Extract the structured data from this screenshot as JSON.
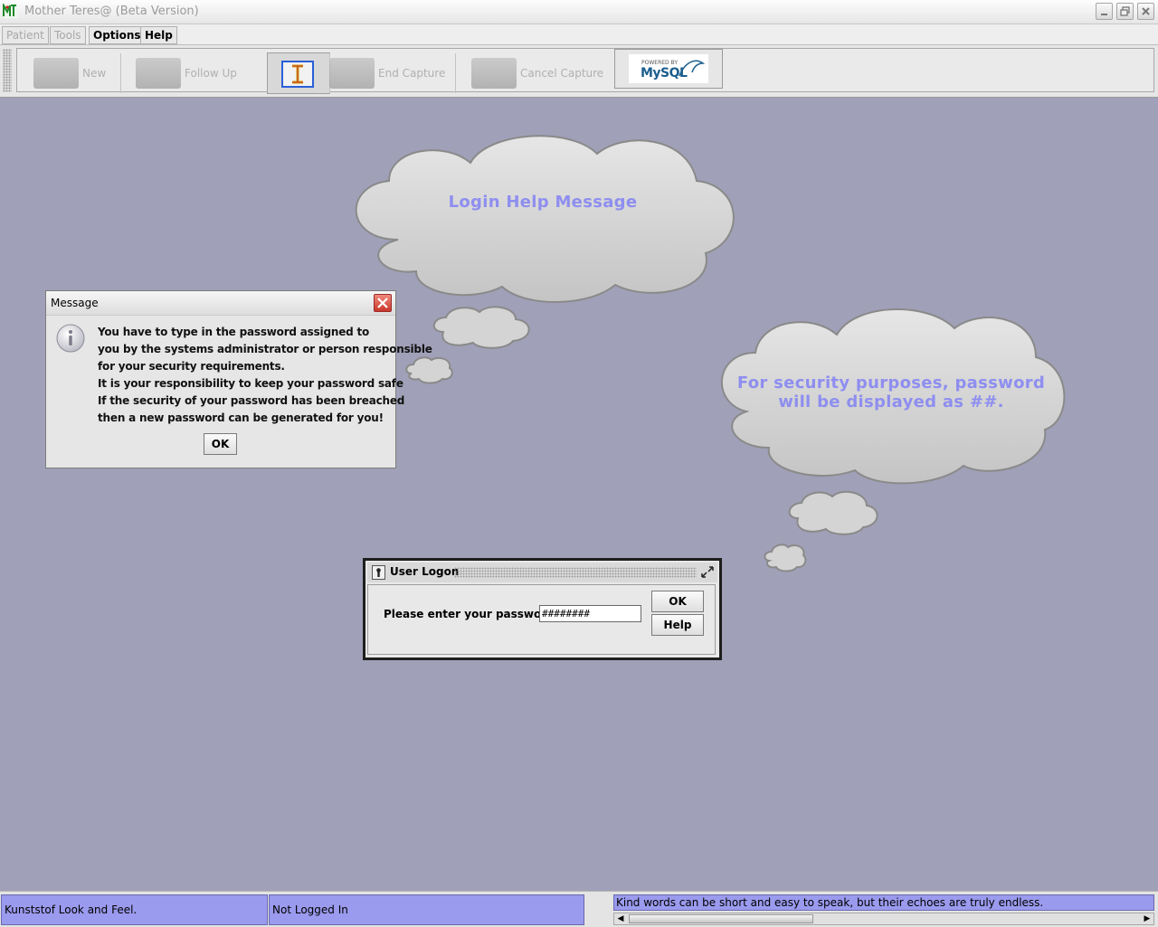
{
  "window": {
    "title": "Mother Teres@ (Beta Version)"
  },
  "menubar": {
    "items": [
      {
        "label": "Patient",
        "enabled": false
      },
      {
        "label": "Tools",
        "enabled": false
      },
      {
        "label": "Options",
        "enabled": true
      },
      {
        "label": "Help",
        "enabled": true
      }
    ]
  },
  "toolbar": {
    "new_label": "New",
    "followup_label": "Follow Up",
    "end_capture_label": "End Capture",
    "cancel_capture_label": "Cancel Capture",
    "mysql_small": "POWERED BY",
    "mysql_big": "MySQL"
  },
  "clouds": {
    "top_text": "Login Help Message",
    "right_line1": "For security purposes, password",
    "right_line2": "will be displayed as ##."
  },
  "message_dialog": {
    "title": "Message",
    "lines": [
      "You have to type in the password assigned to",
      "you by the systems administrator or person responsible",
      "for your security requirements.",
      "It is your responsibility to keep your password safe",
      "If the security of your password has been breached",
      "then a new password can be generated for you!"
    ],
    "ok_label": "OK"
  },
  "logon_dialog": {
    "title": "User Logon",
    "prompt": "Please enter your password:",
    "password_value": "########",
    "ok_label": "OK",
    "help_label": "Help"
  },
  "statusbar": {
    "look_and_feel": "Kunststof Look and Feel.",
    "login_status": "Not Logged In",
    "quote": "Kind words can be short and easy to speak, but their echoes are truly endless."
  },
  "colors": {
    "desktop_bg": "#a0a0b8",
    "status_bg": "#9a9aee",
    "cloud_text": "#8e8ef0"
  }
}
